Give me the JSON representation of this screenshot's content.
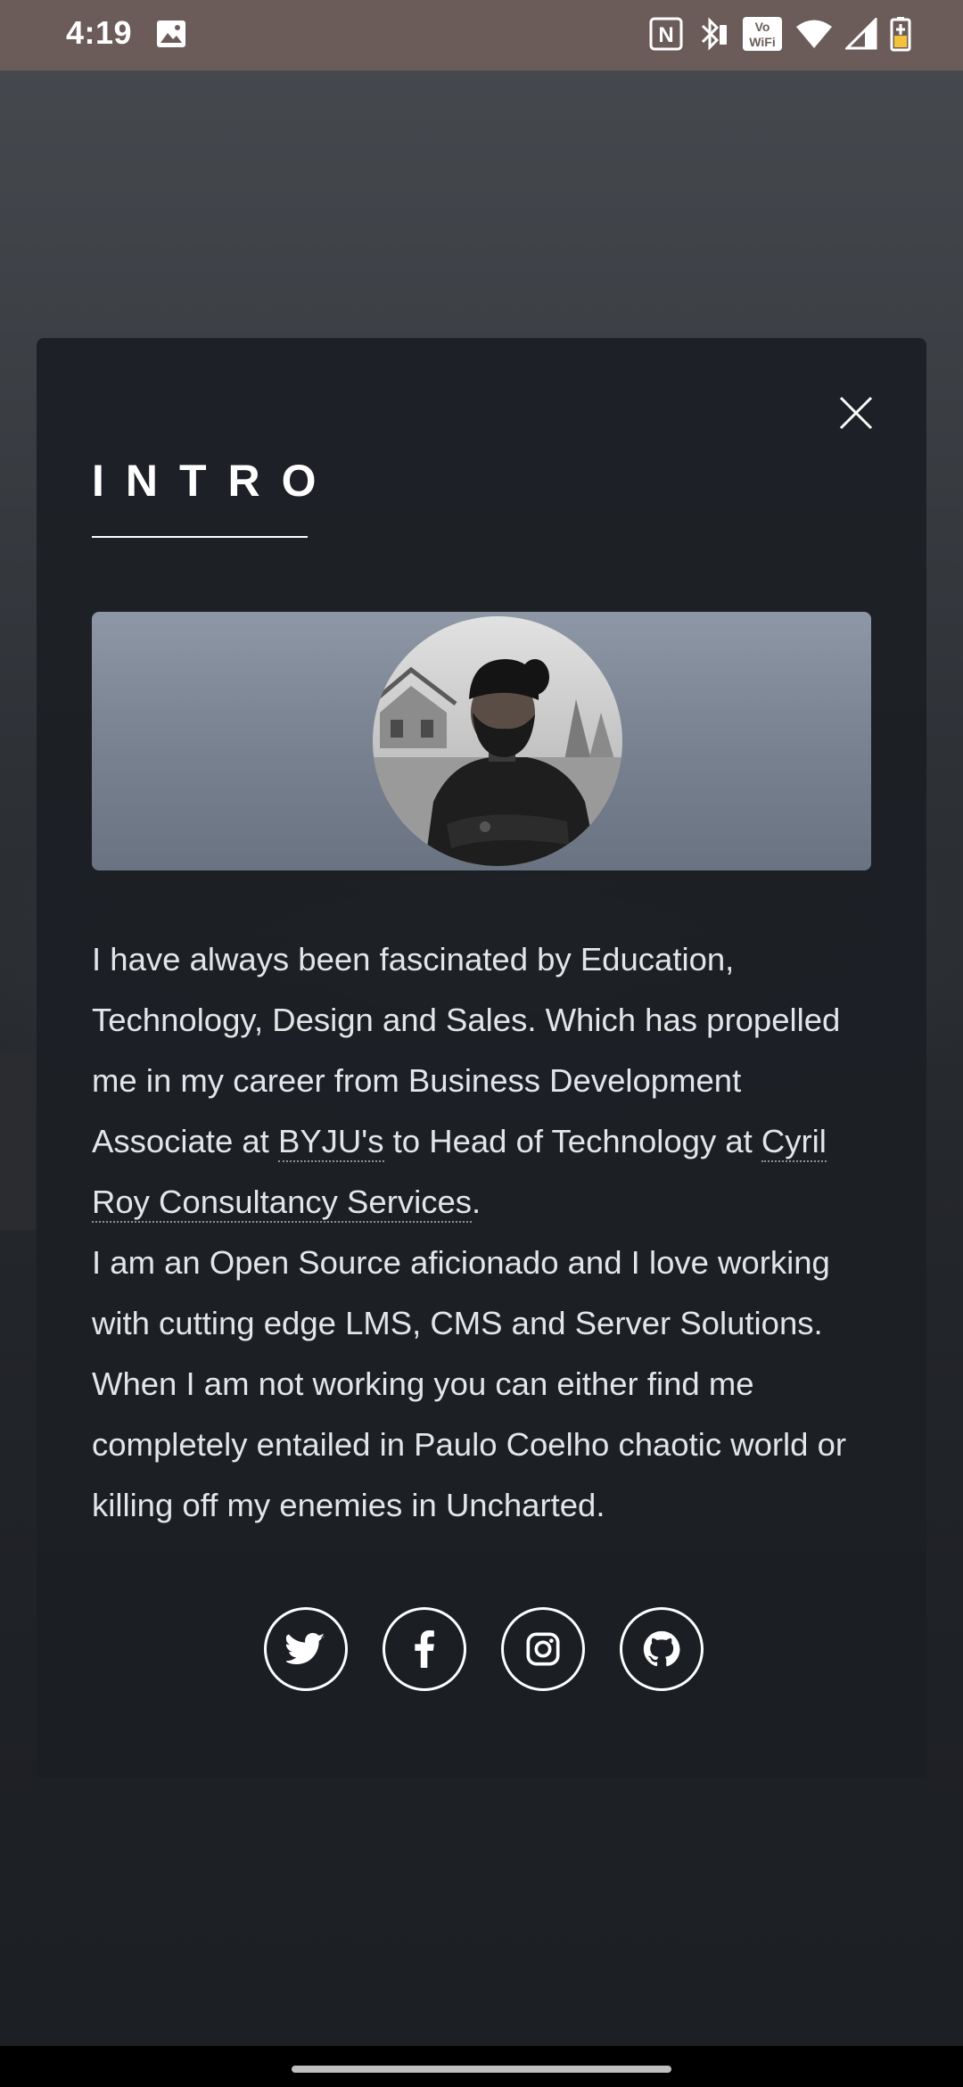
{
  "status_bar": {
    "time": "4:19",
    "icons": [
      "image-notification-icon",
      "nfc-icon",
      "bluetooth-icon",
      "vowifi-icon",
      "wifi-icon",
      "signal-icon",
      "battery-charging-icon"
    ],
    "vowifi_text_top": "Vo",
    "vowifi_text_bottom": "WiFi",
    "nfc_letter": "N"
  },
  "modal": {
    "title": "INTRO",
    "close_icon": "close-icon",
    "profile_image": "profile-photo",
    "bio": {
      "p1_before_link1": "I have always been fascinated by Education, Technology, Design and Sales. Which has propelled me in my career from Business Development Associate at ",
      "link1": "BYJU's",
      "p1_middle": " to Head of Technology at ",
      "link2": "Cyril Roy Consultancy Services",
      "p1_end": ".",
      "p2": "I am an Open Source aficionado and I love working with cutting edge LMS, CMS and Server Solutions. When I am not working you can either find me completely entailed in Paulo Coelho chaotic world or killing off my enemies in Uncharted."
    },
    "social": [
      {
        "icon": "twitter-icon"
      },
      {
        "icon": "facebook-icon"
      },
      {
        "icon": "instagram-icon"
      },
      {
        "icon": "github-icon"
      }
    ]
  },
  "colors": {
    "status_bar": "#6c5c59",
    "modal_bg": "#1c1f24",
    "text": "#e3e5e8",
    "accent": "#ffffff"
  }
}
